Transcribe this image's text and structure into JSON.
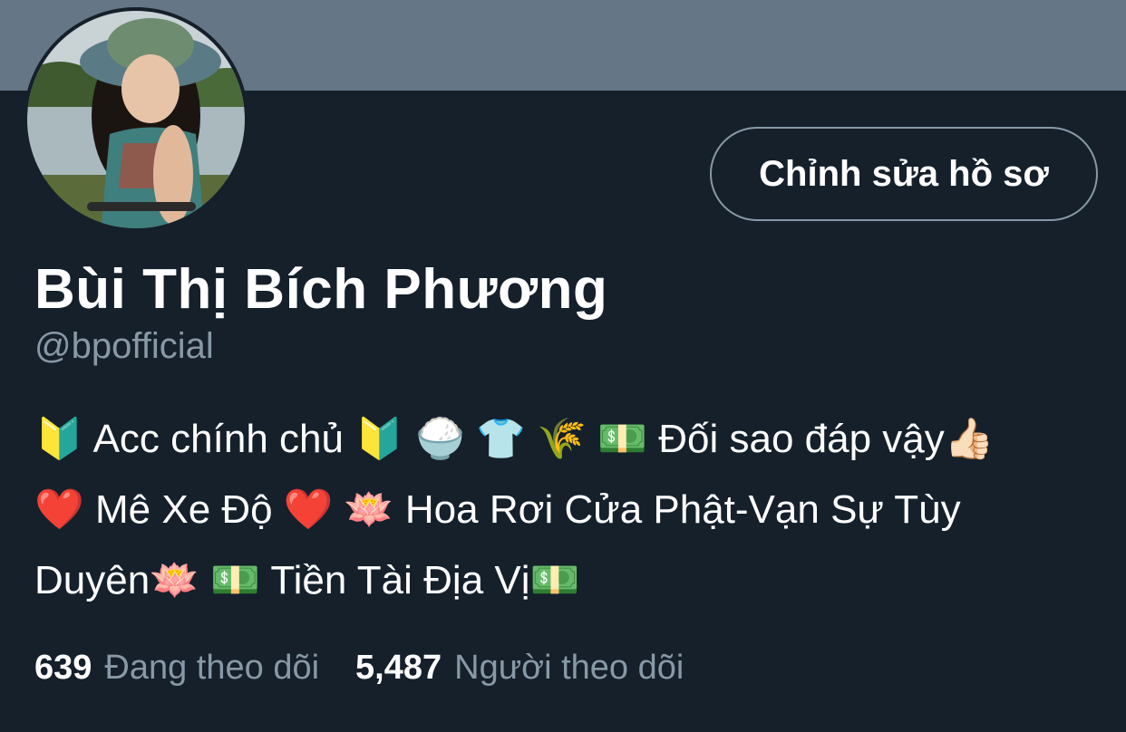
{
  "profile": {
    "display_name": "Bùi Thị Bích Phương",
    "handle": "@bpofficial",
    "edit_button_label": "Chỉnh sửa hồ sơ",
    "bio_lines": [
      "🔰  Acc chính chủ 🔰 🍚 👕 🌾 💵 Đối sao đáp vậy👍🏻",
      "❤️ Mê Xe Độ ❤️ 🪷 Hoa Rơi Cửa Phật-Vạn Sự Tùy",
      "Duyên🪷 💵 Tiền Tài Địa Vị💵"
    ]
  },
  "stats": {
    "following_count": "639",
    "following_label": "Đang theo dõi",
    "followers_count": "5,487",
    "followers_label": "Người theo dõi"
  },
  "colors": {
    "background": "#15202b",
    "banner": "#657786",
    "text_primary": "#ffffff",
    "text_secondary": "#8899a6"
  }
}
